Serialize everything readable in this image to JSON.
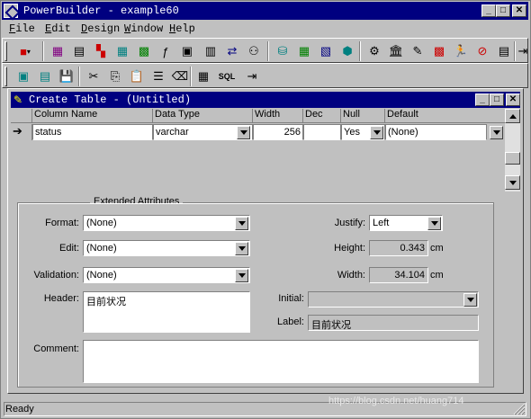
{
  "app": {
    "title": "PowerBuilder - example60"
  },
  "menu": [
    {
      "label": "File",
      "accel": "F"
    },
    {
      "label": "Edit",
      "accel": "E"
    },
    {
      "label": "Design",
      "accel": "D"
    },
    {
      "label": "Window",
      "accel": "W"
    },
    {
      "label": "Help",
      "accel": "H"
    }
  ],
  "toolbar2": {
    "sql_label": "SQL"
  },
  "child": {
    "title": "Create Table - (Untitled)",
    "columns": [
      "Column Name",
      "Data Type",
      "Width",
      "Dec",
      "Null",
      "Default"
    ],
    "row": {
      "name": "status",
      "type": "varchar",
      "width": "256",
      "dec": "",
      "null": "Yes",
      "default": "(None)"
    }
  },
  "ext": {
    "legend": "Extended Attributes",
    "format_label": "Format:",
    "format_value": "(None)",
    "edit_label": "Edit:",
    "edit_value": "(None)",
    "validation_label": "Validation:",
    "validation_value": "(None)",
    "header_label": "Header:",
    "header_value": "目前状况",
    "comment_label": "Comment:",
    "comment_value": "",
    "justify_label": "Justify:",
    "justify_value": "Left",
    "height_label": "Height:",
    "height_value": "0.343",
    "height_unit": "cm",
    "width_label": "Width:",
    "width_value": "34.104",
    "width_unit": "cm",
    "initial_label": "Initial:",
    "initial_value": "",
    "label_label": "Label:",
    "label_value": "目前状况"
  },
  "status": {
    "text": "Ready"
  },
  "watermark": "https://blog.csdn.net/huang714",
  "colors": {
    "titlebar": "#000080",
    "face": "#c0c0c0"
  }
}
